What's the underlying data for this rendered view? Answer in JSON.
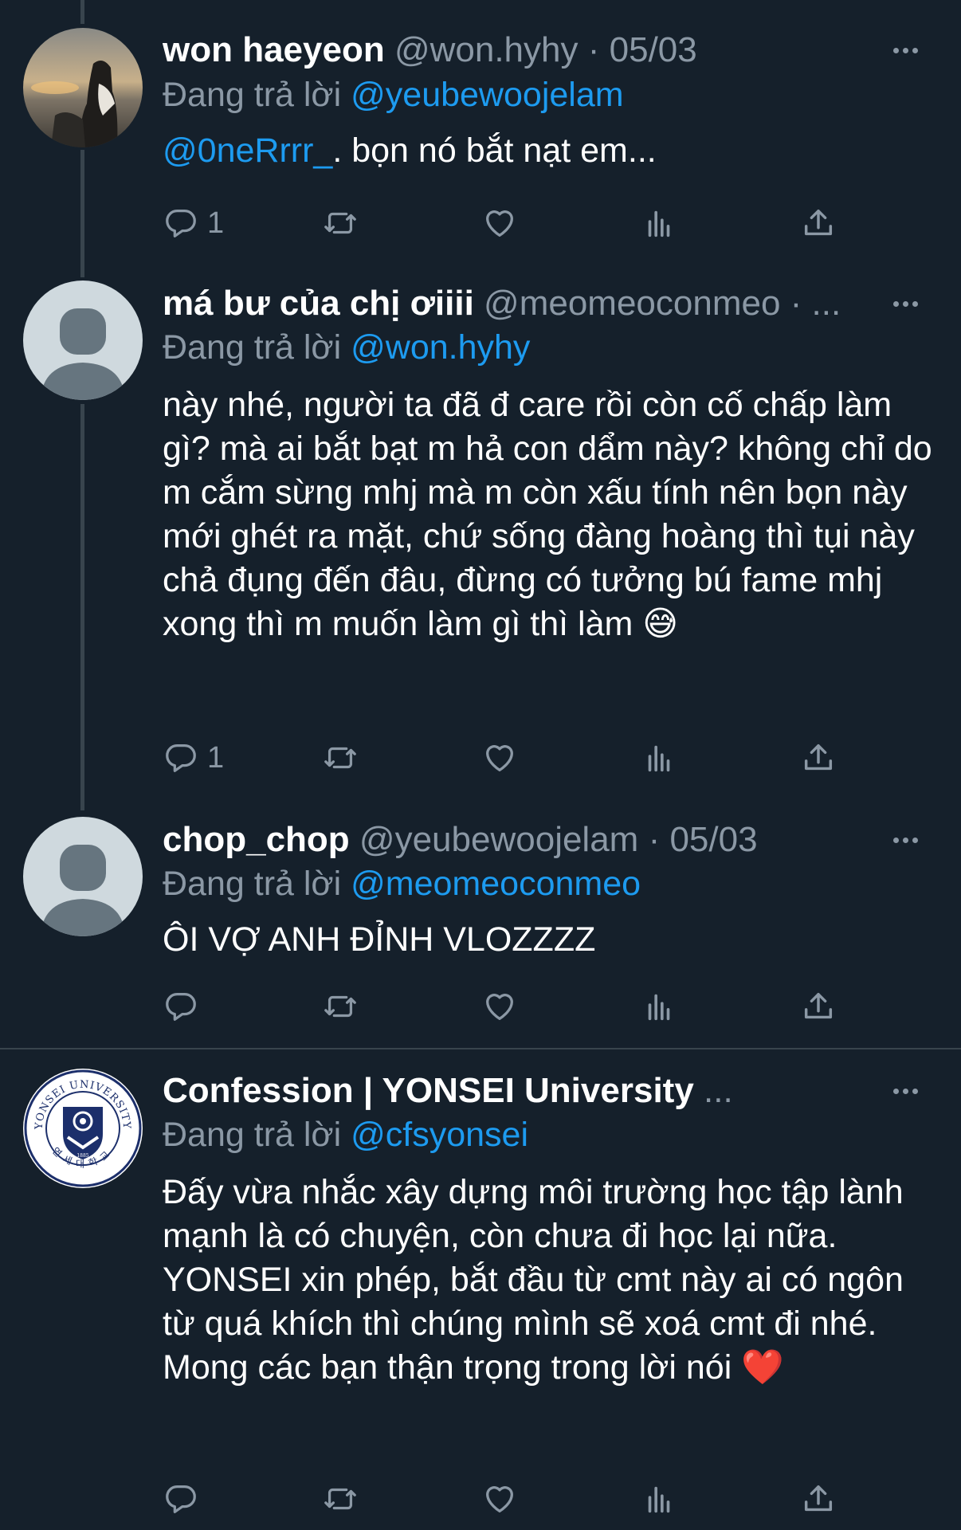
{
  "colors": {
    "background": "#15202b",
    "secondary_text": "#8b98a5",
    "link": "#1d9bf0",
    "divider": "#38444d"
  },
  "tweets": [
    {
      "name": "won haeyeon",
      "handle": "@won.hyhy",
      "date": "· 05/03",
      "replying_prefix": "Đang trả lời ",
      "replying_to": "@yeubewoojelam",
      "mention": "@0neRrrr_",
      "text": ". bọn nó bắt nạt em...",
      "reply_count": "1",
      "avatar": "photo-avatar"
    },
    {
      "name": "má bư của chị ơiiii",
      "handle": "@meomeoconmeo · ...",
      "replying_prefix": "Đang trả lời ",
      "replying_to": "@won.hyhy",
      "text": "này nhé, người ta đã đ care rồi còn cố chấp làm gì? mà ai bắt bạt m hả con dẩm này? không chỉ do m cắm sừng mhj mà m còn xấu tính nên bọn này mới ghét ra mặt, chứ sống đàng hoàng thì tụi này chả đụng đến đâu, đừng có tưởng bú fame mhj xong thì m muốn làm gì thì làm 😅",
      "reply_count": "1",
      "avatar": "default-avatar"
    },
    {
      "name": "chop_chop",
      "handle": "@yeubewoojelam",
      "date": "· 05/03",
      "replying_prefix": "Đang trả lời ",
      "replying_to": "@meomeoconmeo",
      "text": "ÔI VỢ ANH ĐỈNH VLOZZZZ",
      "avatar": "default-avatar"
    },
    {
      "name": "Confession | YONSEI University",
      "handle": "...",
      "replying_prefix": "Đang trả lời ",
      "replying_to": "@cfsyonsei",
      "text": "Đấy vừa nhắc xây dựng môi trường học tập lành mạnh là có chuyện, còn chưa đi học lại nữa. YONSEI xin phép, bắt đầu từ cmt này ai có ngôn từ quá khích thì chúng mình sẽ xoá cmt đi nhé. Mong các bạn thận trọng trong lời nói ❤️",
      "avatar": "university-seal-avatar",
      "seal_text": [
        "YONSEI UNIVERSITY",
        "1885",
        "연세대학교"
      ]
    }
  ],
  "icons": {
    "reply": "reply-icon",
    "retweet": "retweet-icon",
    "like": "heart-icon",
    "views": "views-icon",
    "share": "share-icon",
    "more": "more-options-icon"
  }
}
